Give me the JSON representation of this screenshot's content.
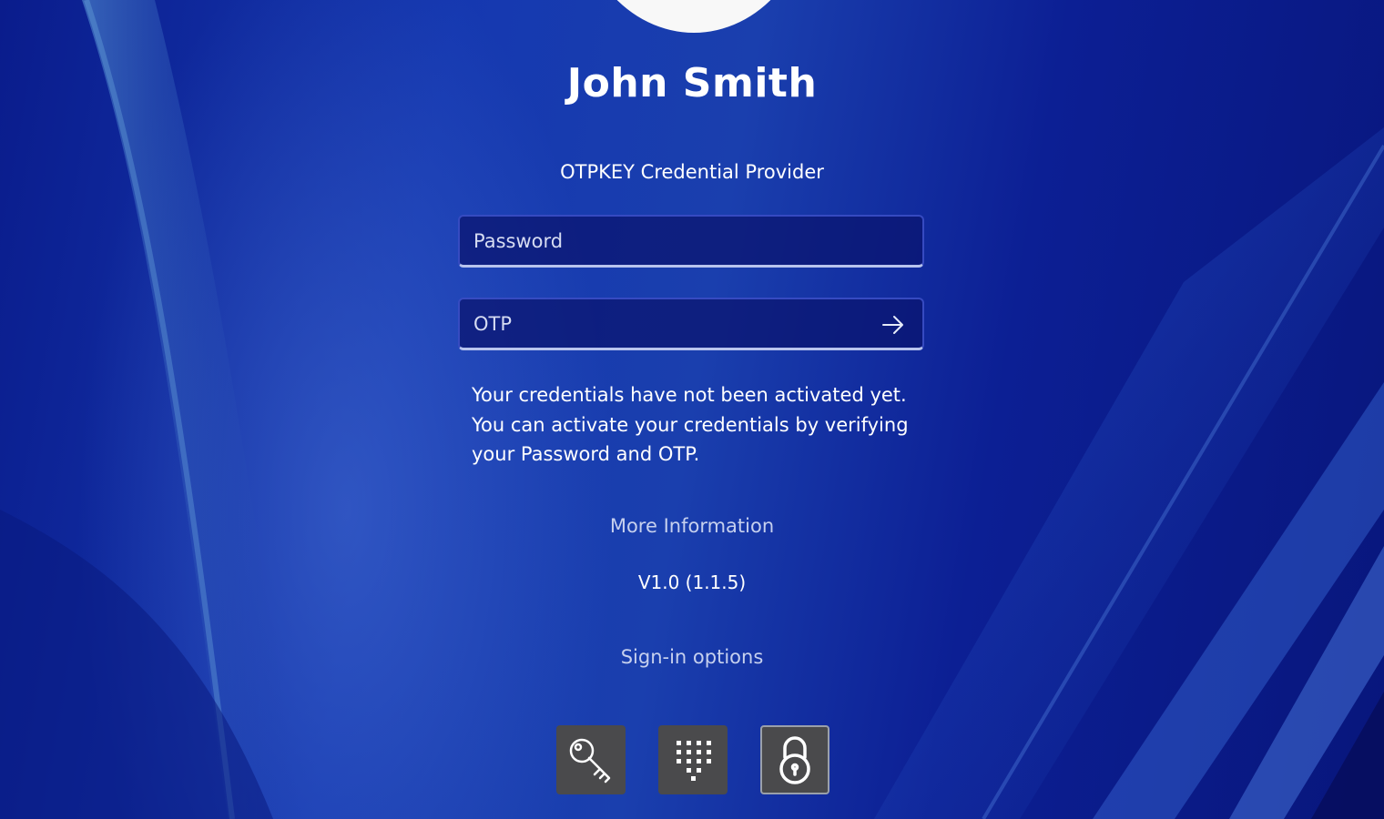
{
  "user": {
    "name": "John Smith"
  },
  "provider": {
    "title": "OTPKEY Credential Provider"
  },
  "password_field": {
    "placeholder": "Password",
    "value": ""
  },
  "otp_field": {
    "placeholder": "OTP",
    "value": "",
    "submit_icon": "arrow-right-icon"
  },
  "notice": {
    "lines": [
      "Your credentials have not been activated yet.",
      "You can activate your credentials by verifying",
      "your Password and OTP."
    ]
  },
  "more_info": {
    "label": "More Information"
  },
  "version": {
    "label": "V1.0 (1.1.5)"
  },
  "signin_options": {
    "label": "Sign-in options",
    "options": [
      {
        "icon": "key-icon",
        "selected": false
      },
      {
        "icon": "pin-keypad-icon",
        "selected": false
      },
      {
        "icon": "lock-icon",
        "selected": true
      }
    ]
  },
  "colors": {
    "background": "#1538b0",
    "field_background": "#0a146e",
    "field_underline": "#b8c4ee",
    "option_button": "#4a4a4c",
    "selected_border": "#9aa0aa"
  }
}
